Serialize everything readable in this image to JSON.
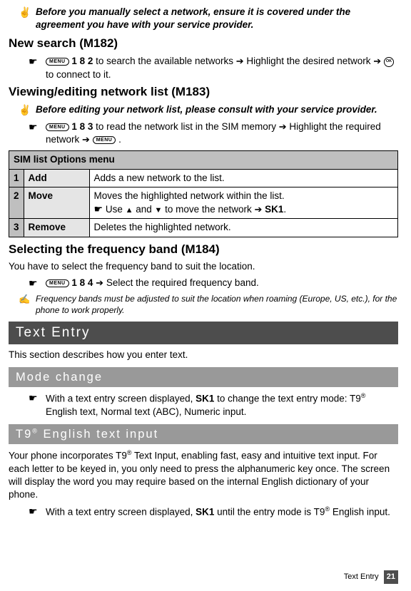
{
  "note1": "Before you manually select a network, ensure it is covered under the agreement you have with your service provider.",
  "h_newsearch": "New search (M182)",
  "m182": {
    "pre": "",
    "code": " 1 8 2",
    "mid": " to search the available networks ",
    "mid2": " Highlight the desired network ",
    "end": " to connect to it."
  },
  "h_viewedit": "Viewing/editing network list (M183)",
  "note2": "Before editing your network list, please consult with your service provider.",
  "m183": {
    "code": " 1 8 3",
    "mid": " to read the network list in the SIM memory ",
    "mid2": " Highlight the required network ",
    "end": " ."
  },
  "table": {
    "title": "SIM list Options menu",
    "rows": [
      {
        "n": "1",
        "name": "Add",
        "desc": "Adds a new network to the list."
      },
      {
        "n": "2",
        "name": "Move",
        "desc": "Moves the highlighted network within the list.",
        "desc2_pre": " Use ",
        "desc2_mid": " and ",
        "desc2_end": " to move the network ",
        "desc2_sk": " SK1",
        "desc2_dot": "."
      },
      {
        "n": "3",
        "name": "Remove",
        "desc": "Deletes the highlighted network."
      }
    ]
  },
  "h_freq": "Selecting the frequency band (M184)",
  "freq_intro": "You have to select the frequency band to suit the location.",
  "m184": {
    "code": " 1 8 4",
    "end": " Select the required frequency band."
  },
  "freq_note": "Frequency bands must be adjusted to suit the location when roaming (Europe, US, etc.), for the phone to work properly.",
  "bar_text_entry": "Text Entry",
  "text_entry_intro": "This section describes how you enter text.",
  "bar_mode": "Mode change",
  "mode_step_pre": "With a text entry screen displayed, ",
  "mode_step_sk": "SK1",
  "mode_step_mid": " to change the text entry mode: T9",
  "mode_step_end": " English text, Normal text (ABC), Numeric input.",
  "bar_t9_pre": "T9",
  "bar_t9_post": " English text input",
  "t9_body_pre": "Your phone incorporates T9",
  "t9_body_post": " Text Input, enabling fast, easy and intuitive text input. For each letter to be keyed in, you only need to press the alphanumeric key once. The screen will display the word you may require based on the internal English dictionary of your phone.",
  "t9_step_pre": "With a text entry screen displayed, ",
  "t9_step_sk": "SK1",
  "t9_step_mid": " until the entry mode is T9",
  "t9_step_end": " English input.",
  "footer_label": "Text Entry",
  "footer_page": "21"
}
